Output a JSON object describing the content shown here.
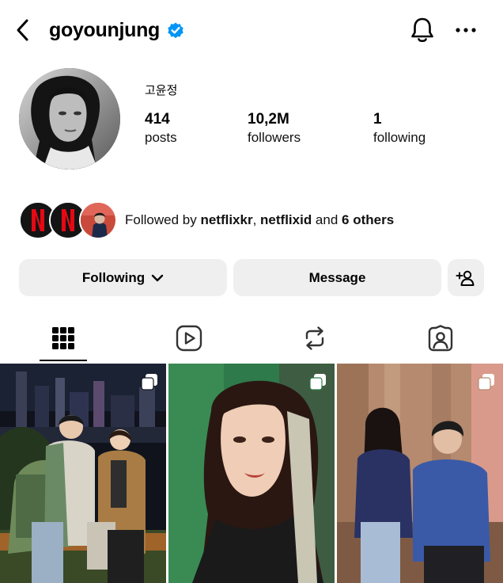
{
  "header": {
    "username": "goyounjung",
    "verified_icon": "verified-badge-icon",
    "back_icon": "chevron-left-icon",
    "bell_icon": "bell-icon",
    "more_icon": "more-horizontal-icon"
  },
  "profile": {
    "full_name": "고윤정",
    "posts_count": "414",
    "posts_label": "posts",
    "followers_count": "10,2M",
    "followers_label": "followers",
    "following_count": "1",
    "following_label": "following"
  },
  "followed_by": {
    "prefix": "Followed by ",
    "user1": "netflixkr",
    "separator": ", ",
    "user2": "netflixid",
    "and_text": " and ",
    "others": "6 others"
  },
  "actions": {
    "following_label": "Following",
    "message_label": "Message",
    "add_person_icon": "add-person-icon"
  },
  "tabs": [
    "grid-icon",
    "reels-icon",
    "reposts-icon",
    "tagged-icon"
  ],
  "colors": {
    "verified_blue": "#0095f6",
    "button_bg": "#efefef",
    "netflix_red": "#e50914"
  }
}
